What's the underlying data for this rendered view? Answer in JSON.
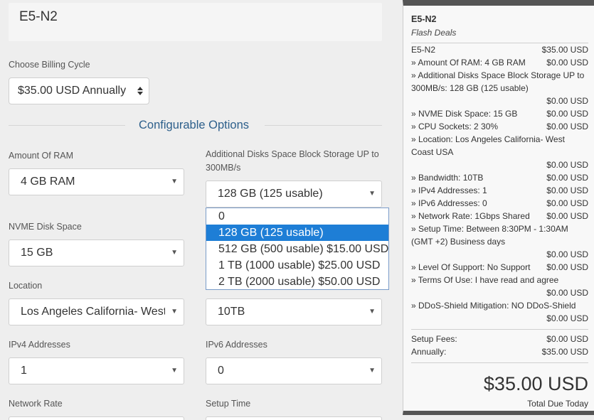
{
  "product": {
    "name": "E5-N2"
  },
  "billing": {
    "label": "Choose Billing Cycle",
    "value": "$35.00 USD Annually"
  },
  "section": {
    "title": "Configurable Options"
  },
  "fields": {
    "ram": {
      "label": "Amount Of RAM",
      "value": "4 GB RAM"
    },
    "disk_block": {
      "label": "Additional Disks Space Block Storage UP to 300MB/s",
      "value": "128 GB (125 usable)"
    },
    "nvme": {
      "label": "NVME Disk Space",
      "value": "15 GB"
    },
    "location": {
      "label": "Location",
      "value": "Los Angeles California- West Coast USA"
    },
    "bandwidth": {
      "value": "10TB"
    },
    "ipv4": {
      "label": "IPv4 Addresses",
      "value": "1"
    },
    "ipv6": {
      "label": "IPv6 Addresses",
      "value": "0"
    },
    "network": {
      "label": "Network Rate"
    },
    "setup": {
      "label": "Setup Time"
    }
  },
  "dropdown": {
    "options": [
      "0",
      "128 GB (125 usable)",
      "512 GB (500 usable) $15.00 USD",
      "1 TB (1000 usable) $25.00 USD",
      "2 TB (2000 usable) $50.00 USD"
    ],
    "selected_index": 1
  },
  "summary": {
    "title": "E5-N2",
    "subtitle": "Flash Deals",
    "product_line": {
      "label": "E5-N2",
      "price": "$35.00 USD"
    },
    "items": [
      {
        "label": "» Amount Of RAM: 4 GB RAM",
        "price": "$0.00 USD"
      },
      {
        "label": "» Additional Disks Space Block Storage UP to 300MB/s: 128 GB (125 usable)",
        "price": "$0.00 USD"
      },
      {
        "label": "» NVME Disk Space: 15 GB",
        "price": "$0.00 USD"
      },
      {
        "label": "» CPU Sockets: 2 30%",
        "price": "$0.00 USD"
      },
      {
        "label": "» Location: Los Angeles California- West Coast USA",
        "price": "$0.00 USD"
      },
      {
        "label": "» Bandwidth: 10TB",
        "price": "$0.00 USD"
      },
      {
        "label": "» IPv4 Addresses: 1",
        "price": "$0.00 USD"
      },
      {
        "label": "» IPv6 Addresses: 0",
        "price": "$0.00 USD"
      },
      {
        "label": "» Network Rate: 1Gbps Shared",
        "price": "$0.00 USD"
      },
      {
        "label": "» Setup Time: Between 8:30PM - 1:30AM (GMT +2) Business days",
        "price": "$0.00 USD"
      },
      {
        "label": "» Level Of Support: No Support",
        "price": "$0.00 USD"
      },
      {
        "label": "» Terms Of Use: I have read and agree",
        "price": "$0.00 USD"
      },
      {
        "label": "» DDoS-Shield Mitigation: NO DDoS-Shield",
        "price": "$0.00 USD"
      }
    ],
    "setup_fees": {
      "label": "Setup Fees:",
      "price": "$0.00 USD"
    },
    "annually": {
      "label": "Annually:",
      "price": "$35.00 USD"
    },
    "total": "$35.00 USD",
    "total_label": "Total Due Today"
  }
}
